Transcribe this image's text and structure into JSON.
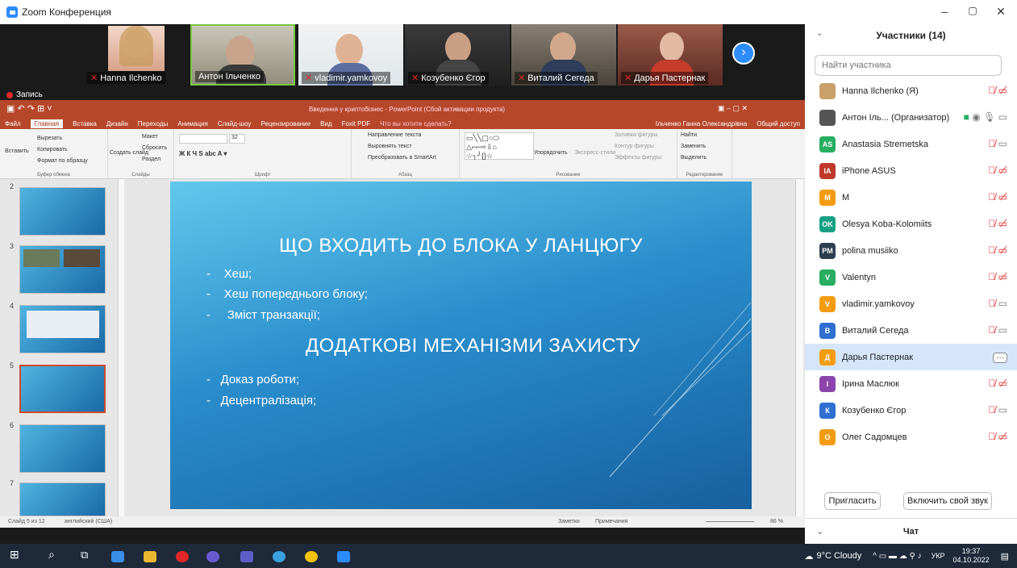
{
  "window": {
    "title": "Zoom Конференция",
    "min": "–",
    "max": "▢",
    "close": "✕"
  },
  "video": {
    "tiles": [
      {
        "name": "Hanna Ilchenko",
        "muted": true
      },
      {
        "name": "Антон Ільченко",
        "muted": false
      },
      {
        "name": "vladimir.yamkovoy",
        "muted": true
      },
      {
        "name": "Козубенко Єгор",
        "muted": true
      },
      {
        "name": "Виталий Сегеда",
        "muted": true
      },
      {
        "name": "Дарья Пастернак",
        "muted": true
      }
    ],
    "next": "›",
    "recording": "Запись"
  },
  "ppt": {
    "title": "Введення у криптобізнес - PowerPoint (Сбой активации продукта)",
    "user": "Ільченко Ганна Олександрівна",
    "share": "Общий доступ",
    "tabs": [
      "Файл",
      "Главная",
      "Вставка",
      "Дизайн",
      "Переходы",
      "Анимация",
      "Слайд-шоу",
      "Рецензирование",
      "Вид",
      "Foxit PDF",
      "Что вы хотите сделать?"
    ],
    "ribbon": {
      "clipboard": {
        "paste": "Вставить",
        "cut": "Вырезать",
        "copy": "Копировать",
        "format": "Формат по образцу",
        "label": "Буфер обмена"
      },
      "slides": {
        "new": "Создать слайд",
        "layout": "Макет",
        "reset": "Сбросить",
        "section": "Раздел",
        "label": "Слайды"
      },
      "font": {
        "size": "32",
        "label": "Шрифт"
      },
      "para": {
        "dir": "Направление текста",
        "align": "Выровнять текст",
        "smart": "Преобразовать в SmartArt",
        "label": "Абзац"
      },
      "draw": {
        "arrange": "Упорядочить",
        "styles": "Экспресс-стили",
        "fill": "Заливка фигуры",
        "outline": "Контур фигуры",
        "effects": "Эффекты фигуры",
        "label": "Рисование"
      },
      "edit": {
        "find": "Найти",
        "replace": "Заменить",
        "select": "Выделить",
        "label": "Редактирование"
      }
    },
    "thumb_numbers": [
      "2",
      "3",
      "4",
      "5",
      "6",
      "7"
    ],
    "slide": {
      "title1": "ЩО ВХОДИТЬ ДО БЛОКА У ЛАНЦЮГУ",
      "bullets1": [
        "Хеш;",
        "Хеш попереднього блоку;",
        "Зміст транзакції;"
      ],
      "title2": "ДОДАТКОВІ МЕХАНІЗМИ ЗАХИСТУ",
      "bullets2": [
        "Доказ роботи;",
        "Децентралізація;"
      ]
    },
    "status": {
      "slide": "Слайд 5 из 12",
      "lang": "английский (США)",
      "notes": "Заметки",
      "comments": "Примечания",
      "zoom": "86 %"
    }
  },
  "participants": {
    "title": "Участники (14)",
    "search_placeholder": "Найти участника",
    "list": [
      {
        "initials": "",
        "name": "Hanna Ilchenko (Я)",
        "color": "#c9a06a",
        "icons": "mic-cam-off"
      },
      {
        "initials": "",
        "name": "Антон Іль... (Организатор)",
        "color": "#555555",
        "icons": "host"
      },
      {
        "initials": "AS",
        "name": "Anastasia Stremetska",
        "color": "#27ae60",
        "icons": "mic-cam"
      },
      {
        "initials": "IA",
        "name": "iPhone ASUS",
        "color": "#c0392b",
        "icons": "mic-cam-off"
      },
      {
        "initials": "M",
        "name": "M",
        "color": "#f39c12",
        "icons": "mic-cam-off"
      },
      {
        "initials": "OK",
        "name": "Olesya Koba-Kolomiits",
        "color": "#16a085",
        "icons": "mic-cam-off"
      },
      {
        "initials": "PM",
        "name": "polina musiiko",
        "color": "#2c3e50",
        "icons": "mic-cam-off"
      },
      {
        "initials": "V",
        "name": "Valentyn",
        "color": "#27ae60",
        "icons": "mic-cam-off"
      },
      {
        "initials": "V",
        "name": "vladimir.yamkovoy",
        "color": "#f39c12",
        "icons": "mic-cam"
      },
      {
        "initials": "В",
        "name": "Виталий Сегеда",
        "color": "#2e6fd1",
        "icons": "mic-cam"
      },
      {
        "initials": "Д",
        "name": "Дарья Пастернак",
        "color": "#f39c12",
        "icons": "more"
      },
      {
        "initials": "І",
        "name": "Ірина Маслюк",
        "color": "#8e44ad",
        "icons": "mic-cam-off"
      },
      {
        "initials": "К",
        "name": "Козубенко Єгор",
        "color": "#2e6fd1",
        "icons": "mic-cam"
      },
      {
        "initials": "О",
        "name": "Олег Садомцев",
        "color": "#f39c12",
        "icons": "mic-cam-off"
      }
    ],
    "invite": "Пригласить",
    "unmute": "Включить свой звук",
    "chat": "Чат"
  },
  "taskbar": {
    "weather": "9°C Cloudy",
    "lang": "УКР",
    "time": "19:37",
    "date": "04.10.2022"
  }
}
